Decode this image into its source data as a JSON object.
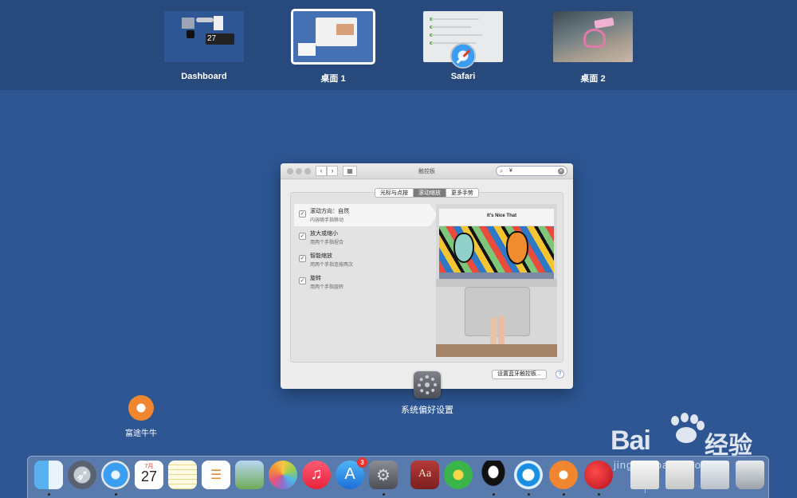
{
  "spaces": {
    "items": [
      {
        "label": "Dashboard",
        "thumb_day": "27"
      },
      {
        "label": "桌面 1",
        "selected": true
      },
      {
        "label": "Safari"
      },
      {
        "label": "桌面 2"
      }
    ]
  },
  "prefs_window": {
    "title": "触控板",
    "search_value": "¥",
    "tabs": [
      "光标与点按",
      "滚动缩放",
      "更多手势"
    ],
    "active_tab": "滚动缩放",
    "options": [
      {
        "title": "滚动方向：自然",
        "desc": "内容随手指移动",
        "checked": true
      },
      {
        "title": "放大或缩小",
        "desc": "用两个手指捏合",
        "checked": true
      },
      {
        "title": "智能缩放",
        "desc": "用两个手指连按两次",
        "checked": true
      },
      {
        "title": "旋转",
        "desc": "用两个手指旋转",
        "checked": true
      }
    ],
    "preview_site_title": "It's Nice That",
    "bluetooth_button": "设置蓝牙触控板...",
    "help_symbol": "?"
  },
  "active_app": {
    "label": "系统偏好设置",
    "icon": "system-preferences-icon"
  },
  "desktop_icon": {
    "label": "富途牛牛",
    "icon": "futu-niuniu-icon"
  },
  "watermark": {
    "brand": "Bai",
    "brand_suffix": "经验",
    "url": "jingyan.baidu.com"
  },
  "dock": {
    "items": [
      {
        "name": "finder",
        "icon": "finder-icon",
        "running": true
      },
      {
        "name": "launchpad",
        "icon": "launchpad-icon",
        "running": false
      },
      {
        "name": "safari",
        "icon": "safari-icon",
        "running": true
      },
      {
        "name": "calendar",
        "icon": "calendar-icon",
        "month": "7月",
        "day": "27",
        "running": false
      },
      {
        "name": "notes",
        "icon": "notes-icon",
        "running": false
      },
      {
        "name": "reminders",
        "icon": "reminders-icon",
        "running": false
      },
      {
        "name": "preview",
        "icon": "preview-icon",
        "running": false
      },
      {
        "name": "photos",
        "icon": "photos-icon",
        "running": false
      },
      {
        "name": "itunes",
        "icon": "music-icon",
        "running": false
      },
      {
        "name": "app-store",
        "icon": "app-store-icon",
        "badge": "3",
        "running": false
      },
      {
        "name": "system-preferences",
        "icon": "system-preferences-icon",
        "running": true
      },
      {
        "name": "dictionary",
        "icon": "dictionary-icon",
        "glyph": "Aa",
        "running": false
      },
      {
        "name": "qq-music",
        "icon": "qq-music-icon",
        "running": false
      },
      {
        "name": "qq",
        "icon": "qq-penguin-icon",
        "running": true
      },
      {
        "name": "qq-browser",
        "icon": "browser-icon",
        "running": true
      },
      {
        "name": "futu",
        "icon": "futu-niuniu-icon",
        "running": true
      },
      {
        "name": "app-red",
        "icon": "red-swirl-icon",
        "running": true
      },
      {
        "name": "downloads",
        "icon": "downloads-stack-icon",
        "running": false
      },
      {
        "name": "documents",
        "icon": "documents-stack-icon",
        "running": false
      },
      {
        "name": "screenshots",
        "icon": "screenshots-stack-icon",
        "running": false
      },
      {
        "name": "trash",
        "icon": "trash-icon",
        "running": false
      }
    ]
  }
}
